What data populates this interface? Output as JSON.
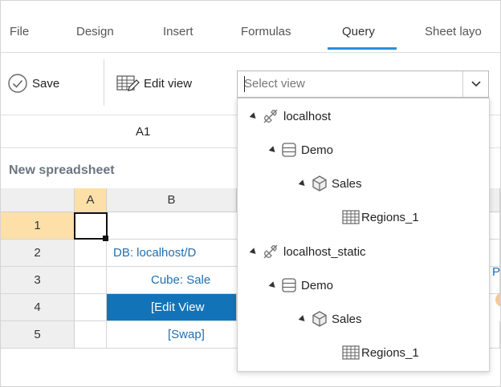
{
  "menu": {
    "tabs": [
      {
        "label": "File"
      },
      {
        "label": "Design"
      },
      {
        "label": "Insert"
      },
      {
        "label": "Formulas"
      },
      {
        "label": "Query"
      },
      {
        "label": "Sheet layo"
      }
    ],
    "active_tab": "Query"
  },
  "toolbar": {
    "save_label": "Save",
    "edit_view_label": "Edit view",
    "select_placeholder": "Select view"
  },
  "namebox": {
    "cell_ref": "A1"
  },
  "sheet": {
    "title": "New spreadsheet",
    "columns": [
      "A",
      "B"
    ],
    "rows": [
      {
        "num": "1",
        "b": ""
      },
      {
        "num": "2",
        "b": "DB: localhost/D"
      },
      {
        "num": "3",
        "b": "Cube: Sale"
      },
      {
        "num": "4",
        "b": "[Edit View"
      },
      {
        "num": "5",
        "b": "[Swap]"
      }
    ],
    "right_edge_text": "Pi"
  },
  "dropdown": {
    "tree": [
      {
        "label": "localhost",
        "icon": "connection-icon"
      },
      {
        "label": "Demo",
        "icon": "database-icon"
      },
      {
        "label": "Sales",
        "icon": "cube-icon"
      },
      {
        "label": "Regions_1",
        "icon": "table-icon"
      },
      {
        "label": "localhost_static",
        "icon": "connection-icon"
      },
      {
        "label": "Demo",
        "icon": "database-icon"
      },
      {
        "label": "Sales",
        "icon": "cube-icon"
      },
      {
        "label": "Regions_1",
        "icon": "table-icon"
      }
    ]
  },
  "colors": {
    "accent": "#2b8fd6",
    "link": "#1f6fb2",
    "selected_cell": "#1373b8",
    "header_highlight": "#fde0a8"
  }
}
